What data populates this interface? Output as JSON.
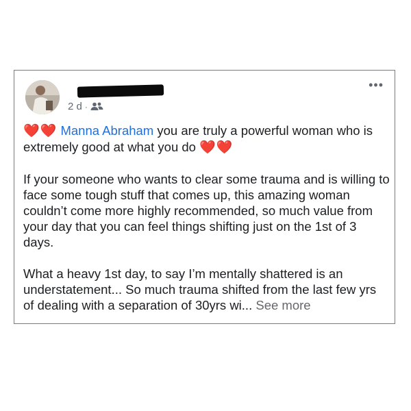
{
  "post": {
    "author_name": "",
    "timestamp": "2 d",
    "separator": "·",
    "audience_icon": "friends-icon",
    "more_menu": "•••",
    "hearts": "❤️❤️",
    "mention": "Manna Abraham",
    "line1_text": " you are truly a powerful woman who is extremely good at what you do ",
    "hearts_end": "❤️❤️",
    "paragraph2": "If your someone who wants to clear some trauma and is willing to face some tough stuff that comes up, this amazing woman couldn’t come more highly recommended, so much value from your day that you can feel things shifting just on the 1st of 3 days.",
    "paragraph3": "What a heavy 1st day, to say I’m mentally shattered is an understatement... So much trauma shifted from the last few yrs of dealing with a separation of 30yrs wi... ",
    "see_more": "See more"
  },
  "colors": {
    "mention": "#216fdb",
    "heart": "#e0242f",
    "meta": "#606770"
  }
}
